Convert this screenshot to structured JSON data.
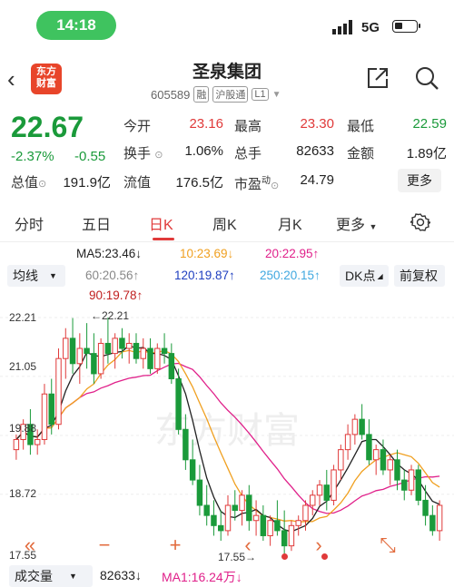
{
  "status": {
    "time": "14:18",
    "network": "5G"
  },
  "nav": {
    "title": "圣泉集团",
    "code": "605589",
    "tags": [
      "融",
      "沪股通",
      "L1"
    ],
    "logo_line1": "东方",
    "logo_line2": "财富"
  },
  "quote": {
    "price": "22.67",
    "change_pct": "-2.37%",
    "change_amt": "-0.55",
    "open_label": "今开",
    "open": "23.16",
    "high_label": "最高",
    "high": "23.30",
    "low_label": "最低",
    "low": "22.59",
    "turnover_label": "换手",
    "turnover": "1.06%",
    "volume_label": "总手",
    "volume": "82633",
    "amount_label": "金额",
    "amount": "1.89亿",
    "mktcap_label": "总值",
    "mktcap": "191.9亿",
    "float_label": "流值",
    "float": "176.5亿",
    "pe_label": "市盈",
    "pe_sup": "动",
    "pe": "24.79",
    "more": "更多"
  },
  "tabs": [
    "分时",
    "五日",
    "日K",
    "周K",
    "月K",
    "更多"
  ],
  "ma": {
    "ma5": "MA5:23.46↓",
    "ma10": "10:23.69↓",
    "ma20": "20:22.95↑",
    "ma60": "60:20.56↑",
    "ma120": "120:19.87↑",
    "ma250": "250:20.15↑",
    "ma90": "90:19.78↑",
    "select_ma": "均线",
    "dk": "DK点",
    "adjust": "前复权",
    "colors": {
      "ma5": "#222222",
      "ma10": "#f0a020",
      "ma20": "#e0208a",
      "ma60": "#888888",
      "ma120": "#2040c0",
      "ma250": "#40a8e0",
      "ma90": "#c02020"
    }
  },
  "chart_data": {
    "type": "candlestick",
    "y_ticks": [
      "22.21",
      "21.05",
      "19.88",
      "18.72",
      "17.55"
    ],
    "ylim": [
      17.55,
      22.21
    ],
    "annotations": [
      "←22.21",
      "17.55→"
    ],
    "watermark": "东方财富",
    "bars": [
      [
        19.6,
        19.9,
        19.4,
        19.8
      ],
      [
        19.8,
        20.2,
        19.6,
        20.1
      ],
      [
        20.1,
        20.4,
        19.5,
        19.7
      ],
      [
        19.7,
        20.0,
        19.5,
        19.8
      ],
      [
        19.8,
        20.9,
        19.7,
        20.7
      ],
      [
        20.7,
        21.0,
        19.9,
        20.1
      ],
      [
        20.1,
        21.6,
        20.0,
        21.4
      ],
      [
        21.4,
        22.0,
        21.0,
        21.8
      ],
      [
        21.8,
        22.2,
        21.1,
        21.3
      ],
      [
        21.3,
        21.9,
        20.9,
        21.6
      ],
      [
        21.6,
        22.1,
        21.2,
        21.5
      ],
      [
        21.5,
        21.9,
        20.9,
        21.1
      ],
      [
        21.1,
        21.8,
        21.0,
        21.7
      ],
      [
        21.7,
        22.21,
        21.3,
        21.5
      ],
      [
        21.5,
        21.9,
        21.2,
        21.8
      ],
      [
        21.8,
        22.0,
        21.4,
        21.6
      ],
      [
        21.6,
        21.9,
        21.3,
        21.7
      ],
      [
        21.7,
        21.9,
        21.3,
        21.4
      ],
      [
        21.4,
        21.8,
        21.2,
        21.6
      ],
      [
        21.6,
        21.8,
        21.1,
        21.2
      ],
      [
        21.2,
        21.7,
        21.1,
        21.6
      ],
      [
        21.6,
        21.9,
        21.3,
        21.5
      ],
      [
        21.5,
        21.7,
        20.9,
        21.0
      ],
      [
        21.0,
        21.2,
        19.9,
        20.0
      ],
      [
        20.0,
        20.3,
        19.2,
        19.4
      ],
      [
        19.4,
        19.8,
        18.9,
        19.0
      ],
      [
        19.0,
        19.3,
        18.3,
        18.5
      ],
      [
        18.5,
        18.9,
        18.1,
        18.3
      ],
      [
        18.3,
        18.6,
        17.9,
        18.1
      ],
      [
        18.1,
        18.4,
        17.8,
        18.0
      ],
      [
        18.0,
        18.7,
        17.9,
        18.5
      ],
      [
        18.5,
        18.8,
        18.2,
        18.4
      ],
      [
        18.4,
        18.8,
        18.1,
        18.7
      ],
      [
        18.7,
        18.9,
        18.0,
        18.2
      ],
      [
        18.2,
        18.6,
        17.9,
        18.3
      ],
      [
        18.3,
        18.5,
        17.8,
        17.9
      ],
      [
        17.9,
        18.3,
        17.7,
        18.2
      ],
      [
        18.2,
        18.6,
        17.9,
        18.0
      ],
      [
        18.0,
        18.4,
        17.55,
        17.7
      ],
      [
        17.7,
        18.2,
        17.6,
        18.1
      ],
      [
        18.1,
        18.3,
        17.9,
        18.2
      ],
      [
        18.2,
        18.6,
        18.0,
        18.5
      ],
      [
        18.5,
        18.8,
        18.3,
        18.7
      ],
      [
        18.7,
        19.0,
        18.5,
        18.9
      ],
      [
        18.9,
        19.2,
        18.4,
        18.6
      ],
      [
        18.6,
        19.3,
        18.5,
        19.2
      ],
      [
        19.2,
        19.7,
        19.0,
        19.6
      ],
      [
        19.6,
        20.1,
        19.4,
        19.9
      ],
      [
        19.9,
        20.3,
        19.7,
        20.2
      ],
      [
        20.2,
        20.5,
        19.8,
        19.9
      ],
      [
        19.9,
        20.2,
        19.3,
        19.4
      ],
      [
        19.4,
        19.7,
        19.1,
        19.6
      ],
      [
        19.6,
        19.8,
        19.1,
        19.2
      ],
      [
        19.2,
        19.5,
        18.9,
        19.4
      ],
      [
        19.4,
        19.6,
        18.8,
        19.0
      ],
      [
        19.0,
        19.2,
        18.6,
        18.8
      ],
      [
        18.8,
        19.3,
        18.7,
        19.2
      ],
      [
        19.2,
        19.3,
        18.5,
        18.6
      ],
      [
        18.6,
        18.9,
        18.1,
        18.3
      ],
      [
        18.3,
        18.5,
        17.9,
        18.0
      ],
      [
        18.0,
        18.6,
        17.8,
        18.5
      ]
    ]
  },
  "controls": {
    "first": "«",
    "zoom_out": "−",
    "zoom_in": "+",
    "prev": "‹",
    "next": "›",
    "fullscreen": "⤡"
  },
  "volume": {
    "selector": "成交量",
    "value": "82633↓",
    "ma1": "MA1:16.24万↓"
  }
}
